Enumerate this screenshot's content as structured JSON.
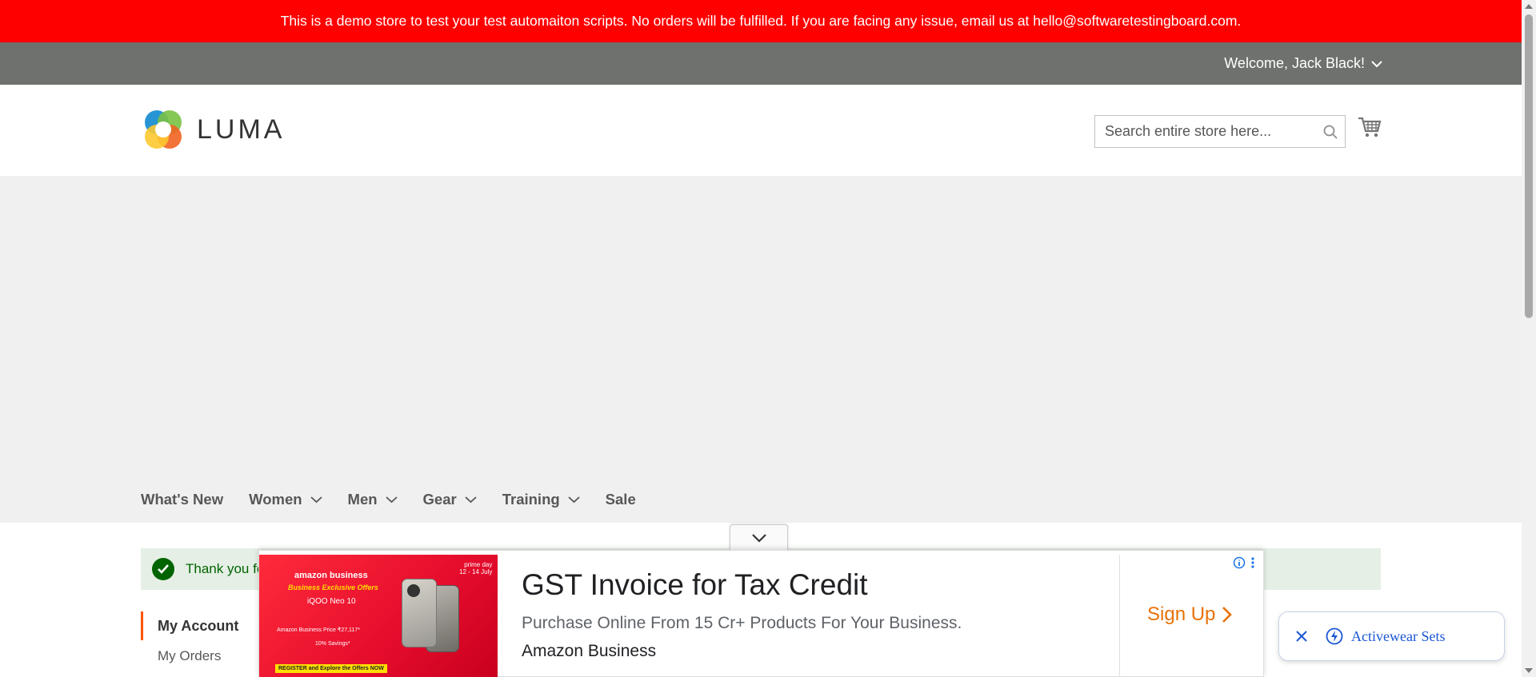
{
  "demo_notice": "This is a demo store to test your test automaiton scripts. No orders will be fulfilled. If you are facing any issue, email us at hello@softwaretestingboard.com.",
  "top_bar": {
    "welcome": "Welcome, Jack Black!"
  },
  "header": {
    "logo_text": "LUMA",
    "search_placeholder": "Search entire store here...",
    "icons": [
      "luma-logo-icon",
      "search-icon",
      "cart-icon"
    ]
  },
  "nav": {
    "items": [
      {
        "label": "What's New",
        "has_dropdown": false
      },
      {
        "label": "Women",
        "has_dropdown": true
      },
      {
        "label": "Men",
        "has_dropdown": true
      },
      {
        "label": "Gear",
        "has_dropdown": true
      },
      {
        "label": "Training",
        "has_dropdown": true
      },
      {
        "label": "Sale",
        "has_dropdown": false
      }
    ]
  },
  "message": {
    "text": "Thank you fo"
  },
  "account_nav": {
    "title": "My Account",
    "items": [
      "My Orders"
    ]
  },
  "ad": {
    "image_text": {
      "brand": "amazon business",
      "tagline": "Business Exclusive Offers",
      "product": "iQOO Neo 10",
      "price": "Amazon Business Price ₹27,117*",
      "savings": "10% Savings*",
      "register": "REGISTER and Explore the Offers NOW",
      "prime_day": "prime day",
      "dates": "12 - 14 July"
    },
    "headline": "GST Invoice for Tax Credit",
    "description": "Purchase Online From 15 Cr+ Products For Your Business.",
    "advertiser": "Amazon Business",
    "cta": "Sign Up"
  },
  "chip": {
    "label": "Activewear Sets"
  },
  "colors": {
    "demo_banner": "#ff0000",
    "top_bar": "#6e716e",
    "success_text": "#006400",
    "success_bg": "#e5efe5",
    "account_accent": "#ff5501",
    "ad_cta": "#e8710a",
    "chip_text": "#1a56d6"
  }
}
